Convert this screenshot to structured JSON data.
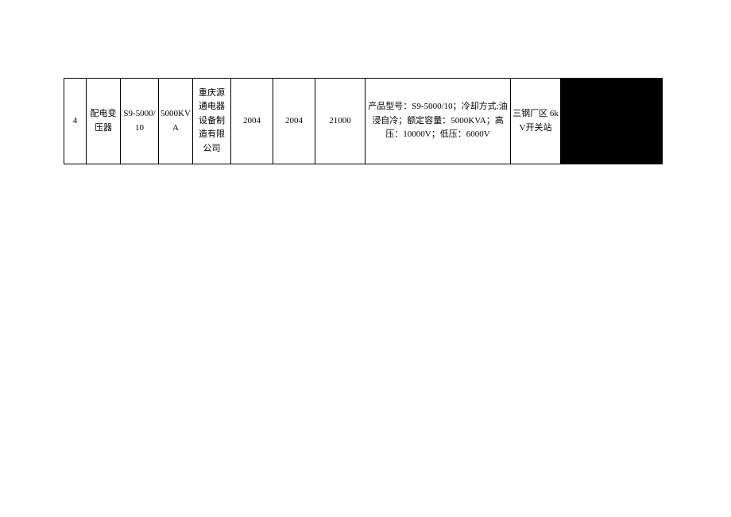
{
  "table": {
    "rows": [
      {
        "index": "4",
        "name": "配电变压器",
        "model": "S9-5000/10",
        "capacity": "5000KVA",
        "manufacturer": "重庆源通电器设备制造有限公司",
        "year1": "2004",
        "year2": "2004",
        "value": "21000",
        "spec": "产品型号：S9-5000/10；冷却方式:油浸自冷；额定容量：5000KVA；高压：10000V；低压：6000V",
        "location": "三钢厂区 6kV开关站",
        "extra": ""
      }
    ]
  }
}
